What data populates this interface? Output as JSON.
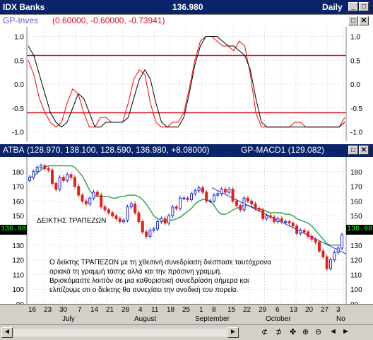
{
  "window": {
    "title": "IDX Banks",
    "price": "136.980",
    "period": "Daily"
  },
  "colors": {
    "titlebar": "#0a246a",
    "candle_up": "#1a2adb",
    "candle_down": "#e2231a",
    "ma_line": "#3aa657",
    "trend_line": "#2222cc",
    "osc_fast": "#ff0000",
    "osc_slow": "#000000"
  },
  "osc_pane": {
    "name": "GP-Inves",
    "values_text": "(0.60000, -0.60000, -0.73941)",
    "y_ticks": [
      "1.0",
      "0.5",
      "0.0",
      "-0.5",
      "-1.0"
    ],
    "right_ticks": [
      "1.0",
      "0.5",
      "0.0",
      "-0.5",
      "-1.0"
    ],
    "upper_level": 0.6,
    "lower_level": -0.6
  },
  "price_pane": {
    "symbol": "ATBA",
    "values_text": "(128.970, 138.100, 128.590, 136.980, +8.08000)",
    "indicator": "GP-MACD1 (129.082)",
    "y_ticks": [
      "180",
      "170",
      "160",
      "150",
      "140",
      "130",
      "120",
      "110",
      "100",
      "90"
    ],
    "right_ticks": [
      "180",
      "170",
      "160",
      "150",
      "140",
      "130",
      "120",
      "110",
      "100",
      "90"
    ],
    "last_price_left": "136.98",
    "last_price_right": "136.98",
    "label_index": "ΔΕΙΚΤΗΣ ΤΡΑΠΕΖΩΝ",
    "comment_lines": [
      "Ο δείκτης ΤΡΑΠΕΖΩΝ με τη χθεσινή συνεδρίαση διέσπασε ταυτόχρονα",
      "οριακά τη γραμμή τάσης αλλά και την πράσινη γραμμή.",
      "Βρισκόμαστε λοιπόν σε μια καθοριστική συνεδρίαση σήμερα και",
      "ελπίζουμε οτι ο δείκτης θα συνεχίσει την ανοδική του πορεία."
    ]
  },
  "date_axis": {
    "days": [
      "16",
      "23",
      "30",
      "7",
      "14",
      "21",
      "28",
      "4",
      "11",
      "18",
      "25",
      "1",
      "8",
      "15",
      "22",
      "29",
      "6",
      "13",
      "20",
      "27",
      "3"
    ],
    "months": [
      "July",
      "August",
      "September",
      "October",
      "No"
    ]
  },
  "toolbar": {
    "scroll_left": "◄",
    "scroll_right": "►",
    "icons": [
      "⊄",
      "⊅",
      "✤",
      "⊕",
      "⊖",
      "◄",
      "►"
    ]
  },
  "chart_data": {
    "type": "line",
    "title": "ATBA",
    "price": {
      "series": [
        {
          "name": "ATBA close",
          "values": [
            176,
            180,
            183,
            184,
            182,
            181,
            172,
            168,
            176,
            174,
            178,
            176,
            170,
            164,
            160,
            158,
            162,
            166,
            164,
            156,
            154,
            152,
            150,
            148,
            146,
            147,
            156,
            158,
            152,
            146,
            139,
            136,
            140,
            141,
            146,
            148,
            145,
            150,
            156,
            155,
            162,
            162,
            161,
            165,
            167,
            169,
            166,
            160,
            160,
            164,
            165,
            168,
            166,
            168,
            160,
            157,
            154,
            162,
            160,
            158,
            155,
            154,
            148,
            150,
            149,
            146,
            148,
            146,
            146,
            145,
            143,
            138,
            140,
            139,
            136,
            134,
            132,
            126,
            122,
            114,
            120,
            125,
            128,
            137
          ]
        },
        {
          "name": "GP-MACD1",
          "values": [
            176,
            177,
            179,
            181,
            183,
            184,
            184,
            184,
            184,
            184,
            184,
            184,
            183,
            180,
            177,
            172,
            167,
            164,
            163,
            163,
            163,
            163,
            162,
            162,
            163,
            163,
            164,
            164,
            164,
            163,
            161,
            158,
            154,
            150,
            148,
            147,
            146,
            147,
            147,
            148,
            149,
            151,
            153,
            155,
            158,
            160,
            161,
            161,
            160,
            157,
            153,
            151,
            151,
            152,
            154,
            155,
            156,
            157,
            157,
            156,
            155,
            155,
            154,
            153,
            152,
            152,
            152,
            152,
            151,
            151,
            150,
            148,
            147,
            146,
            145,
            143,
            140,
            137,
            134,
            131,
            130,
            130,
            130,
            130
          ]
        },
        {
          "name": "Trend line",
          "values": [
            null
          ]
        }
      ],
      "ylim": [
        90,
        190
      ]
    },
    "oscillator": {
      "series": [
        {
          "name": "fast",
          "values": [
            0.5,
            0.2,
            -0.3,
            -0.6,
            -0.8,
            -0.9,
            -0.8,
            -0.4,
            -0.1,
            -0.2,
            -0.6,
            -0.9,
            -0.9,
            -0.7,
            -0.7,
            -0.8,
            -0.8,
            -0.8,
            -0.4,
            0.1,
            0.3,
            0.2,
            -0.4,
            -0.8,
            -0.9,
            -0.9,
            -0.8,
            -0.8,
            -0.6,
            -0.1,
            0.5,
            0.9,
            1.0,
            1.0,
            0.9,
            0.8,
            0.8,
            0.7,
            0.9,
            0.8,
            0.2,
            -0.6,
            -0.9,
            -0.9,
            -0.9,
            -0.9,
            -0.9,
            -0.9,
            -0.8,
            -0.8,
            -0.9,
            -0.9,
            -0.9,
            -0.9,
            -0.9,
            -0.9,
            -0.9,
            -0.7
          ]
        },
        {
          "name": "slow",
          "values": [
            0.8,
            0.6,
            0.2,
            -0.2,
            -0.6,
            -0.8,
            -0.9,
            -0.8,
            -0.5,
            -0.2,
            -0.3,
            -0.6,
            -0.9,
            -0.9,
            -0.8,
            -0.8,
            -0.8,
            -0.8,
            -0.7,
            -0.3,
            0.1,
            0.3,
            0.1,
            -0.4,
            -0.8,
            -0.9,
            -0.9,
            -0.9,
            -0.7,
            -0.2,
            0.4,
            0.8,
            1.0,
            1.0,
            1.0,
            0.9,
            0.8,
            0.8,
            0.7,
            0.6,
            0.3,
            -0.3,
            -0.8,
            -0.9,
            -0.9,
            -0.9,
            -0.9,
            -0.9,
            -0.9,
            -0.9,
            -0.9,
            -0.9,
            -0.9,
            -0.9,
            -0.9,
            -0.9,
            -0.9,
            -0.8
          ]
        }
      ],
      "ylim": [
        -1.2,
        1.2
      ]
    }
  }
}
